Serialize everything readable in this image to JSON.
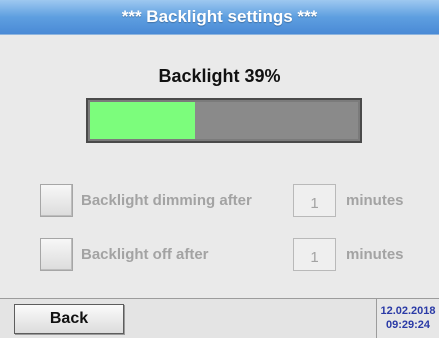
{
  "header": {
    "title": "***  Backlight settings  ***"
  },
  "backlight": {
    "heading": "Backlight 39%",
    "level_percent": 39,
    "colors": {
      "fill": "#7cfd7c",
      "track": "#8a8a8a"
    }
  },
  "options": {
    "dimming": {
      "label": "Backlight dimming after",
      "value": "1",
      "unit": "minutes",
      "checked": false
    },
    "off": {
      "label": "Backlight off after",
      "value": "1",
      "unit": "minutes",
      "checked": false
    }
  },
  "footer": {
    "back_label": "Back",
    "date": "12.02.2018",
    "time": "09:29:24"
  }
}
